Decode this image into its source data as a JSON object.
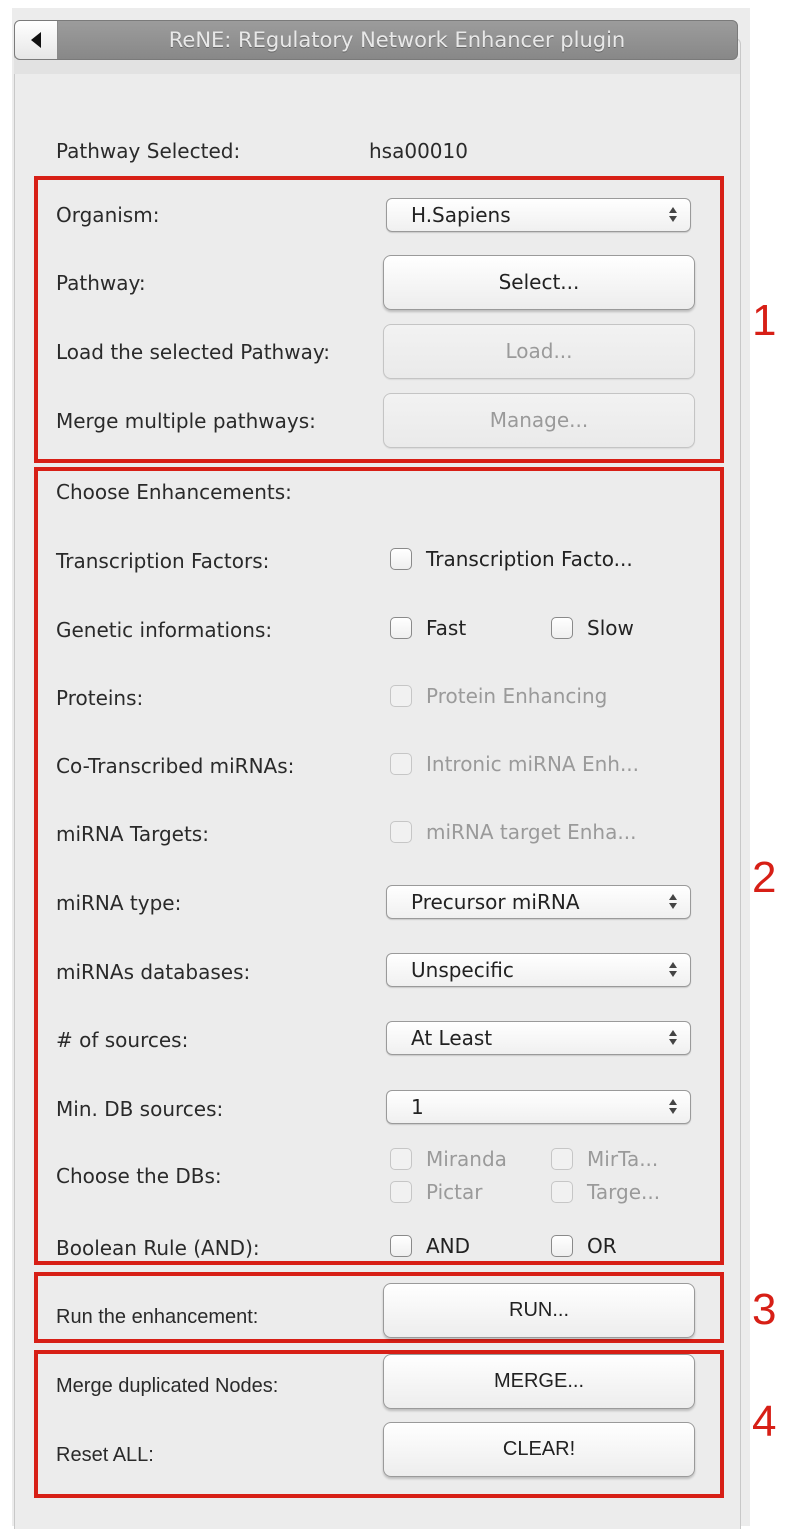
{
  "window": {
    "title": "ReNE: REgulatory Network Enhancer plugin"
  },
  "pathway_selected": {
    "label": "Pathway Selected:",
    "value": "hsa00010"
  },
  "section1": {
    "number": "1",
    "organism": {
      "label": "Organism:",
      "selected": "H.Sapiens"
    },
    "pathway": {
      "label": "Pathway:",
      "button": "Select..."
    },
    "load": {
      "label": "Load the selected Pathway:",
      "button": "Load...",
      "enabled": false
    },
    "merge_multiple": {
      "label": "Merge multiple pathways:",
      "button": "Manage...",
      "enabled": false
    }
  },
  "section2": {
    "number": "2",
    "heading": "Choose Enhancements:",
    "transcription_factors": {
      "label": "Transcription Factors:",
      "checkbox": "Transcription Facto...",
      "checked": false
    },
    "genetic_informations": {
      "label": "Genetic informations:",
      "fast": "Fast",
      "slow": "Slow",
      "fast_checked": false,
      "slow_checked": false
    },
    "proteins": {
      "label": "Proteins:",
      "checkbox": "Protein Enhancing",
      "enabled": false
    },
    "co_transcribed": {
      "label": "Co-Transcribed miRNAs:",
      "checkbox": "Intronic miRNA Enh...",
      "enabled": false
    },
    "mirna_targets": {
      "label": "miRNA Targets:",
      "checkbox": "miRNA target Enha...",
      "enabled": false
    },
    "mirna_type": {
      "label": "miRNA type:",
      "selected": "Precursor miRNA"
    },
    "mirna_databases": {
      "label": "miRNAs databases:",
      "selected": "Unspecific"
    },
    "num_sources": {
      "label": "# of sources:",
      "selected": "At Least"
    },
    "min_db_sources": {
      "label": "Min. DB sources:",
      "selected": "1"
    },
    "choose_dbs": {
      "label": "Choose the DBs:",
      "options": [
        "Miranda",
        "MirTa...",
        "Pictar",
        "Targe..."
      ],
      "enabled": false
    },
    "boolean_rule": {
      "label": "Boolean Rule (AND):",
      "and": "AND",
      "or": "OR"
    }
  },
  "section3": {
    "number": "3",
    "run": {
      "label": "Run the enhancement:",
      "button": "RUN..."
    }
  },
  "section4": {
    "number": "4",
    "merge_nodes": {
      "label": "Merge duplicated Nodes:",
      "button": "MERGE..."
    },
    "reset": {
      "label": "Reset ALL:",
      "button": "CLEAR!"
    }
  },
  "colors": {
    "annotation_red": "#d71f16",
    "panel_bg": "#ececec"
  }
}
